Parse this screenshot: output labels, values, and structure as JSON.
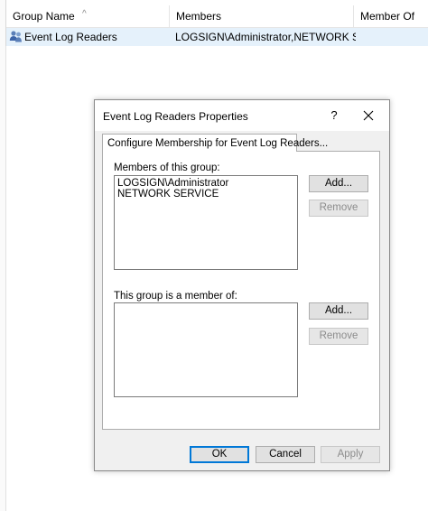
{
  "listview": {
    "columns": [
      "Group Name",
      "Members",
      "Member Of"
    ],
    "sort_indicator": "^",
    "rows": [
      {
        "icon": "group-icon",
        "name": "Event Log Readers",
        "members": "LOGSIGN\\Administrator,NETWORK SE...",
        "member_of": ""
      }
    ]
  },
  "dialog": {
    "title": "Event Log Readers Properties",
    "help_label": "?",
    "close_label": "✕",
    "tab_label": "Configure Membership for Event Log Readers...",
    "members_label": "Members of this group:",
    "members": [
      "LOGSIGN\\Administrator",
      "NETWORK SERVICE"
    ],
    "member_of_label": "This group is a member of:",
    "member_of": [],
    "add_label": "Add...",
    "remove_label": "Remove",
    "ok_label": "OK",
    "cancel_label": "Cancel",
    "apply_label": "Apply"
  },
  "colors": {
    "selection": "#e5f1fb",
    "dialog_bg": "#f0f0f0",
    "accent": "#0078d7"
  }
}
